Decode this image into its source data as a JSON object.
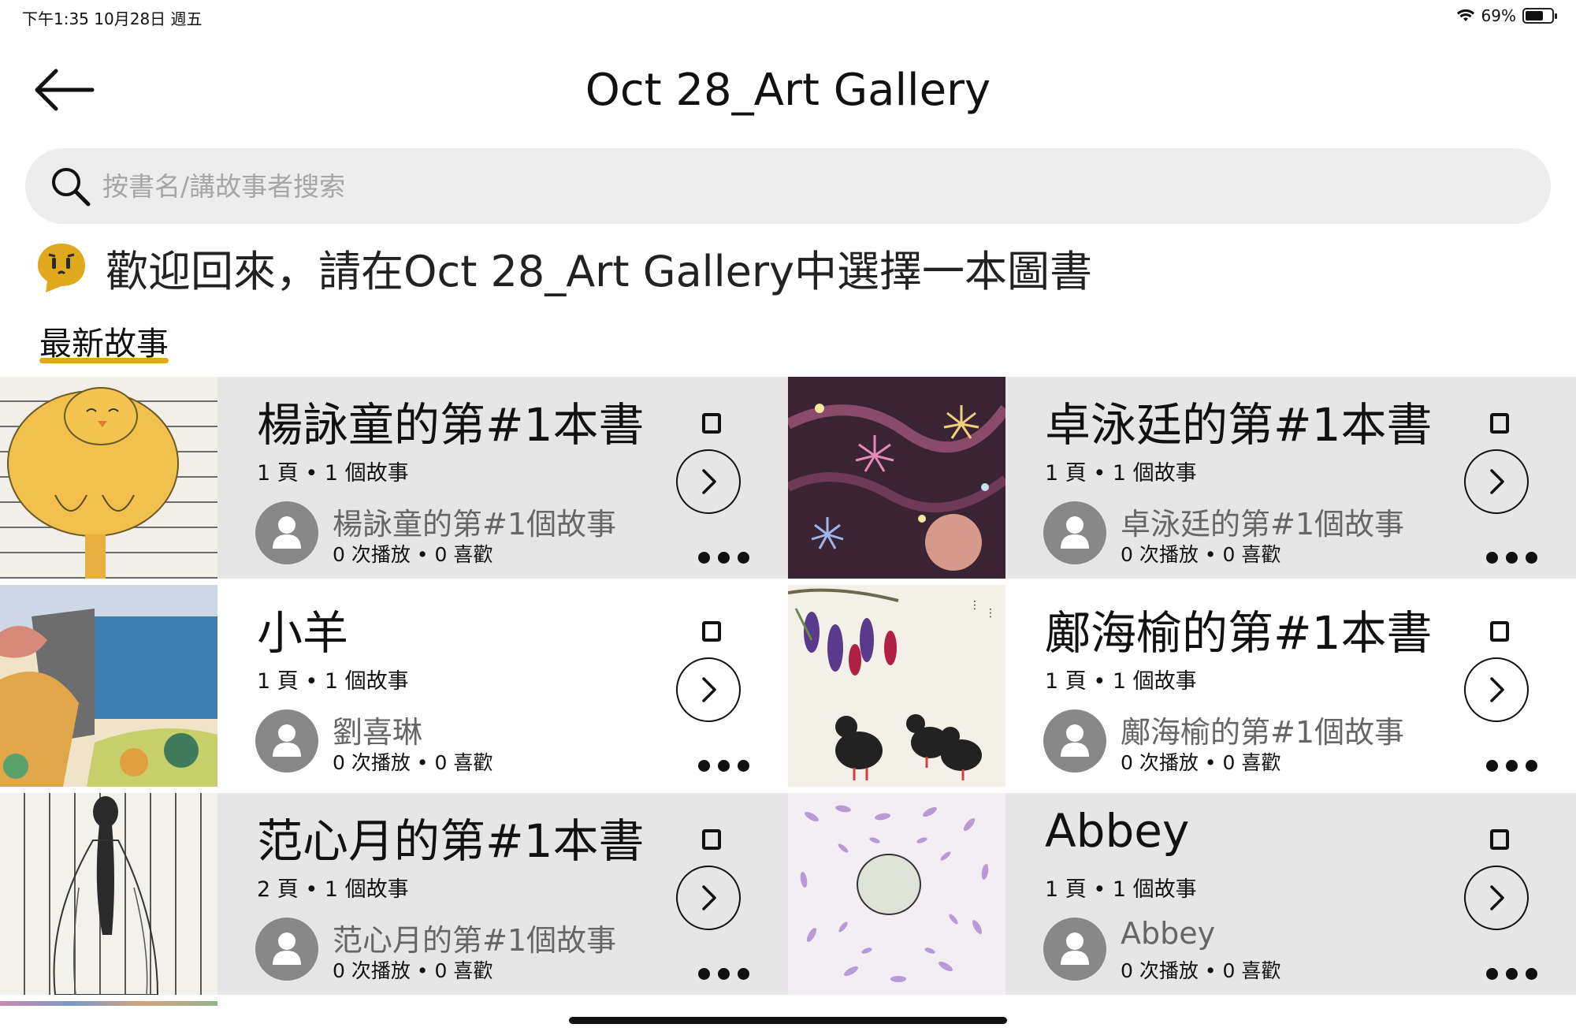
{
  "status_bar": {
    "time": "下午1:35   10月28日 週五",
    "battery_text": "69%",
    "battery_level": 0.69
  },
  "header": {
    "title": "Oct 28_Art Gallery"
  },
  "search": {
    "placeholder": "按書名/講故事者搜索"
  },
  "welcome": {
    "text": "歡迎回來，請在Oct 28_Art Gallery中選擇一本圖書"
  },
  "tabs": [
    {
      "label": "最新故事",
      "active": true
    }
  ],
  "colors": {
    "accent": "#e0a91d",
    "card_gray": "#e6e6e6"
  },
  "books": [
    {
      "title": "楊詠童的第#1本書",
      "meta": "1 頁 • 1 個故事",
      "author": "楊詠童的第#1個故事",
      "stats": "0 次播放 • 0 喜歡",
      "thumbnail": "yellow-bird-drawing"
    },
    {
      "title": "卓泳廷的第#1本書",
      "meta": "1 頁 • 1 個故事",
      "author": "卓泳廷的第#1個故事",
      "stats": "0 次播放 • 0 喜歡",
      "thumbnail": "fireworks-painting"
    },
    {
      "title": "小羊",
      "meta": "1 頁 • 1 個故事",
      "author": "劉喜琳",
      "stats": "0 次播放 • 0 喜歡",
      "thumbnail": "seaside-cliff-painting"
    },
    {
      "title": "鄺海榆的第#1本書",
      "meta": "1 頁 • 1 個故事",
      "author": "鄺海榆的第#1個故事",
      "stats": "0 次播放 • 0 喜歡",
      "thumbnail": "wisteria-chicks-ink-painting"
    },
    {
      "title": "范心月的第#1本書",
      "meta": "2 頁 • 1 個故事",
      "author": "范心月的第#1個故事",
      "stats": "0 次播放 • 0 喜歡",
      "thumbnail": "girl-sketch"
    },
    {
      "title": "Abbey",
      "meta": "1 頁 • 1 個故事",
      "author": "Abbey",
      "stats": "0 次播放 • 0 喜歡",
      "thumbnail": "lavender-spiral-painting"
    }
  ]
}
